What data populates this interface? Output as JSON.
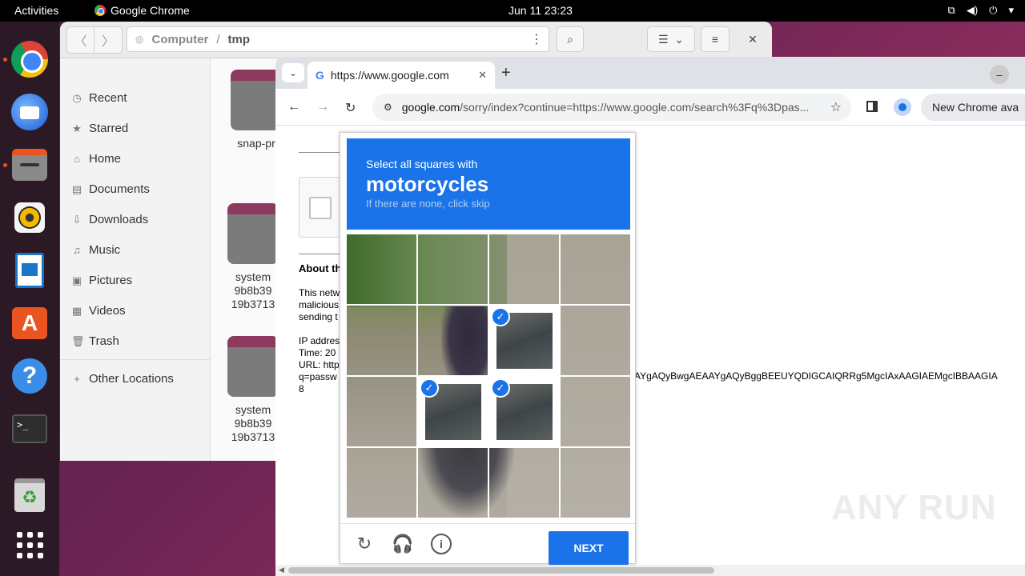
{
  "topbar": {
    "activities": "Activities",
    "app_name": "Google Chrome",
    "clock": "Jun 11  23:23",
    "tray_icons": [
      "network-icon",
      "volume-icon",
      "power-icon",
      "chevron-down-icon"
    ]
  },
  "dock": {
    "apps": [
      "chrome-icon",
      "thunderbird-icon",
      "files-icon",
      "rhythmbox-icon",
      "libreoffice-writer-icon",
      "app-center-icon",
      "help-icon",
      "terminal-icon",
      "trash-icon",
      "show-apps-icon"
    ]
  },
  "files": {
    "path_root": "Computer",
    "path_sep": "/",
    "path_current": "tmp",
    "sidebar": [
      {
        "label": "Recent",
        "icon": "clock-icon"
      },
      {
        "label": "Starred",
        "icon": "star-icon"
      },
      {
        "label": "Home",
        "icon": "home-icon"
      },
      {
        "label": "Documents",
        "icon": "document-icon"
      },
      {
        "label": "Downloads",
        "icon": "download-icon"
      },
      {
        "label": "Music",
        "icon": "music-icon"
      },
      {
        "label": "Pictures",
        "icon": "picture-icon"
      },
      {
        "label": "Videos",
        "icon": "video-icon"
      },
      {
        "label": "Trash",
        "icon": "trash-icon"
      }
    ],
    "other_locations": "Other Locations",
    "items": [
      {
        "name": "snap-pr"
      },
      {
        "name": "system\n9b8b39\n19b3713"
      },
      {
        "name": "system\n9b8b39\n19b3713"
      }
    ]
  },
  "chrome": {
    "tab_title": "https://www.google.com",
    "url_host": "google.com",
    "url_rest": "/sorry/index?continue=https://www.google.com/search%3Fq%3Dpas...",
    "new_chrome": "New Chrome ava"
  },
  "page": {
    "about": "About th",
    "body_lines": "This netw\nmalicious\nsending t",
    "info_lines": "IP addres\nTime: 20\nURL: http\nq=passw\n8",
    "long_url_tail": "AYgAQyBwgAEAAYgAQyBggBEEUYQDIGCAIQRRg5MgcIAxAAGIAEMgcIBBAAGIA"
  },
  "captcha": {
    "line1": "Select all squares with",
    "target": "motorcycles",
    "hint": "If there are none, click skip",
    "next": "NEXT",
    "selected_tiles": [
      "r1c2",
      "r2c1",
      "r2c2"
    ]
  },
  "watermark": "ANY RUN"
}
